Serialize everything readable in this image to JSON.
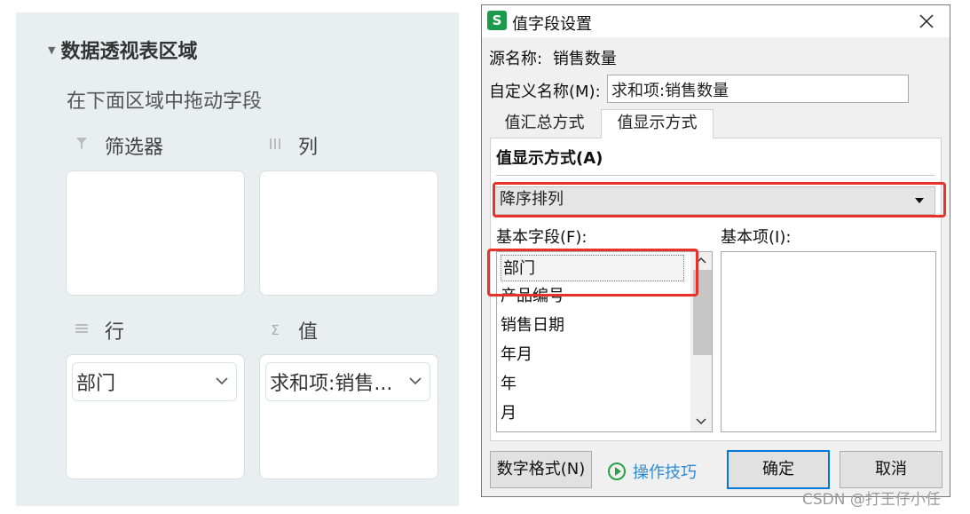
{
  "pivot_panel": {
    "title": "数据透视表区域",
    "hint": "在下面区域中拖动字段",
    "zones": {
      "filter": {
        "label": "筛选器",
        "icon": "filter-icon"
      },
      "columns": {
        "label": "列",
        "icon": "columns-icon"
      },
      "rows": {
        "label": "行",
        "icon": "rows-icon",
        "chip": "部门"
      },
      "values": {
        "label": "值",
        "icon": "sigma-icon",
        "chip": "求和项:销售..."
      }
    }
  },
  "dialog": {
    "title": "值字段设置",
    "source_label": "源名称:",
    "source_value": "销售数量",
    "custom_name_label": "自定义名称(M):",
    "custom_name_value": "求和项:销售数量",
    "tabs": [
      {
        "label": "值汇总方式",
        "active": false
      },
      {
        "label": "值显示方式",
        "active": true
      }
    ],
    "show_values_as_heading": "值显示方式(A)",
    "show_values_as_selected": "降序排列",
    "base_field_label": "基本字段(F):",
    "base_item_label": "基本项(I):",
    "base_fields": [
      "部门",
      "产品编号",
      "销售日期",
      "年月",
      "年",
      "月"
    ],
    "base_fields_selected": "部门",
    "buttons": {
      "number_format": "数字格式(N)",
      "tips": "操作技巧",
      "ok": "确定",
      "cancel": "取消"
    }
  },
  "watermark": "CSDN @打王仔小任",
  "colors": {
    "highlight_red": "#e8312a",
    "app_green": "#1a9a4a",
    "link_blue": "#2e8bd3"
  }
}
